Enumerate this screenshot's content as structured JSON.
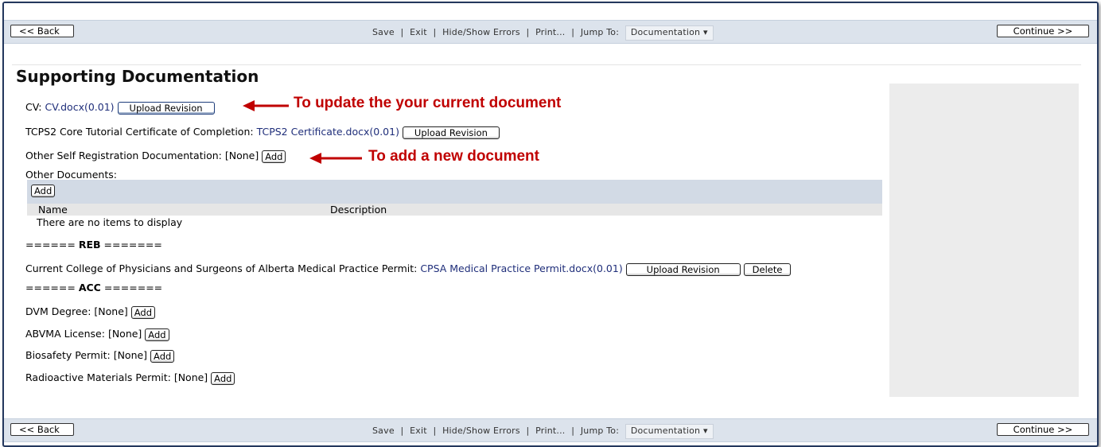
{
  "nav": {
    "back_label": "<< Back",
    "continue_label": "Continue >>",
    "save": "Save",
    "exit": "Exit",
    "hide_show_errors": "Hide/Show Errors",
    "print": "Print...",
    "jump_to_label": "Jump To:",
    "jump_to_value": "Documentation",
    "jump_caret": "▾",
    "separator": "|"
  },
  "page_title": "Supporting Documentation",
  "cv": {
    "label": "CV:",
    "file": "CV.docx(0.01)",
    "button": "Upload Revision"
  },
  "tcps2": {
    "label": "TCPS2 Core Tutorial Certificate of Completion:",
    "file": "TCPS2 Certificate.docx(0.01)",
    "button": "Upload Revision"
  },
  "self_registration": {
    "label": "Other Self Registration Documentation:",
    "value": "[None]",
    "button": "Add"
  },
  "other_documents": {
    "label": "Other Documents:",
    "add_button": "Add",
    "columns": [
      "Name",
      "Description"
    ],
    "empty_message": "There are no items to display"
  },
  "reb_header": {
    "prefix": "====== ",
    "label": "REB",
    "suffix": " ======="
  },
  "cpsa": {
    "label": "Current College of Physicians and Surgeons of Alberta Medical Practice Permit:",
    "file": "CPSA Medical Practice Permit.docx(0.01)",
    "upload_button": "Upload Revision",
    "delete_button": "Delete"
  },
  "acc_header": {
    "prefix": "====== ",
    "label": "ACC",
    "suffix": " ======="
  },
  "acc_items": [
    {
      "label": "DVM Degree:",
      "value": "[None]",
      "button": "Add"
    },
    {
      "label": "ABVMA License:",
      "value": "[None]",
      "button": "Add"
    },
    {
      "label": "Biosafety Permit:",
      "value": "[None]",
      "button": "Add"
    },
    {
      "label": "Radioactive Materials Permit:",
      "value": "[None]",
      "button": "Add"
    }
  ],
  "annotations": {
    "update": "To update the your current document",
    "add": "To add a new document",
    "color": "#c00000"
  }
}
